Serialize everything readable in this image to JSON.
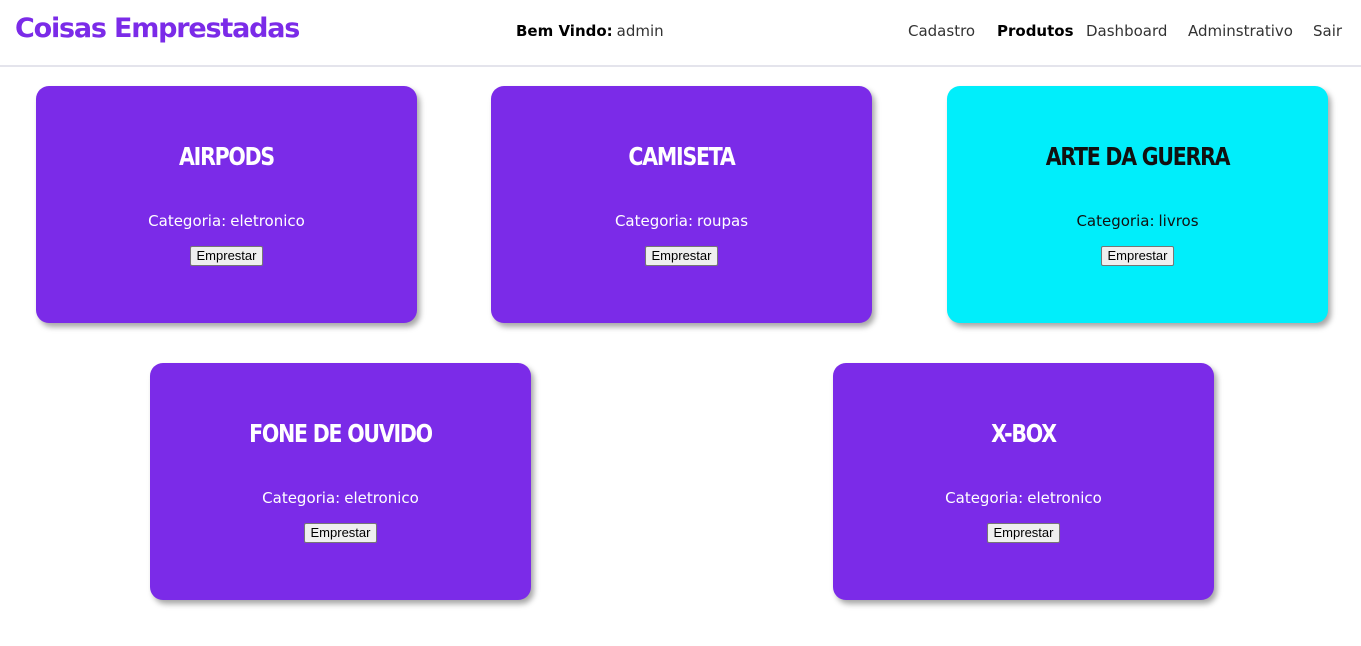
{
  "brand": "Coisas Emprestadas",
  "welcome": {
    "label": "Bem Vindo:",
    "user": "admin"
  },
  "nav": [
    "Cadastro",
    "Produtos",
    "Dashboard",
    "Adminstrativo",
    "Sair"
  ],
  "nav_active": "Produtos",
  "category_label": "Categoria:",
  "button_label": "Emprestar",
  "products": [
    {
      "name": "AIRPODS",
      "category": "eletronico",
      "color": "#7b2be8"
    },
    {
      "name": "CAMISETA",
      "category": "roupas",
      "color": "#7b2be8"
    },
    {
      "name": "ARTE DA GUERRA",
      "category": "livros",
      "color": "#00eefb"
    },
    {
      "name": "FONE DE OUVIDO",
      "category": "eletronico",
      "color": "#7b2be8"
    },
    {
      "name": "X-BOX",
      "category": "eletronico",
      "color": "#7b2be8"
    }
  ]
}
